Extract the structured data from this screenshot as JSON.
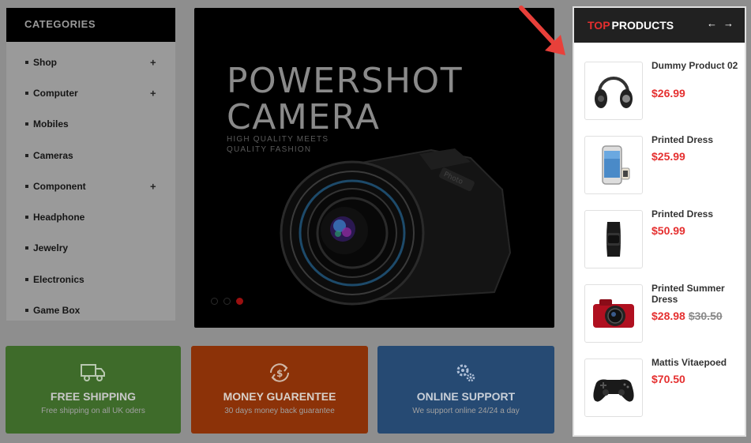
{
  "categories": {
    "title": "CATEGORIES",
    "items": [
      {
        "label": "Shop",
        "expandable": true
      },
      {
        "label": "Computer",
        "expandable": true
      },
      {
        "label": "Mobiles",
        "expandable": false
      },
      {
        "label": "Cameras",
        "expandable": false
      },
      {
        "label": "Component",
        "expandable": true
      },
      {
        "label": "Headphone",
        "expandable": false
      },
      {
        "label": "Jewelry",
        "expandable": false
      },
      {
        "label": "Electronics",
        "expandable": false
      },
      {
        "label": "Game Box",
        "expandable": false
      }
    ],
    "expand_symbol": "+"
  },
  "banner": {
    "title": "POWERSHOT\nCAMERA",
    "subtitle": "HIGH QUALITY MEETS\nQUALITY FASHION",
    "slides": 3,
    "active_slide": 3
  },
  "features": [
    {
      "icon": "truck-icon",
      "title": "FREE SHIPPING",
      "desc": "Free shipping on all UK oders",
      "color": "#3e6b2a"
    },
    {
      "icon": "dollar-cycle-icon",
      "title": "MONEY GUARENTEE",
      "desc": "30 days money back guarantee",
      "color": "#8c3208"
    },
    {
      "icon": "gears-icon",
      "title": "ONLINE SUPPORT",
      "desc": "We support online 24/24 a day",
      "color": "#264a73"
    }
  ],
  "top_products": {
    "title_accent": "TOP",
    "title_rest": "PRODUCTS",
    "prev_symbol": "←",
    "next_symbol": "→",
    "items": [
      {
        "name": "Dummy Product 02",
        "price": "$26.99",
        "old_price": "",
        "image": "headphones"
      },
      {
        "name": "Printed Dress",
        "price": "$25.99",
        "old_price": "",
        "image": "smartphone-watch"
      },
      {
        "name": "Printed Dress",
        "price": "$50.99",
        "old_price": "",
        "image": "fitness-band"
      },
      {
        "name": "Printed Summer Dress",
        "price": "$28.98",
        "old_price": "$30.50",
        "image": "red-camera"
      },
      {
        "name": "Mattis Vitaepoed",
        "price": "$70.50",
        "old_price": "",
        "image": "gamepad"
      }
    ]
  },
  "colors": {
    "accent_red": "#e52e2e",
    "overlay_gray": "#8e8e8e",
    "annotation_arrow": "#e8403a"
  }
}
